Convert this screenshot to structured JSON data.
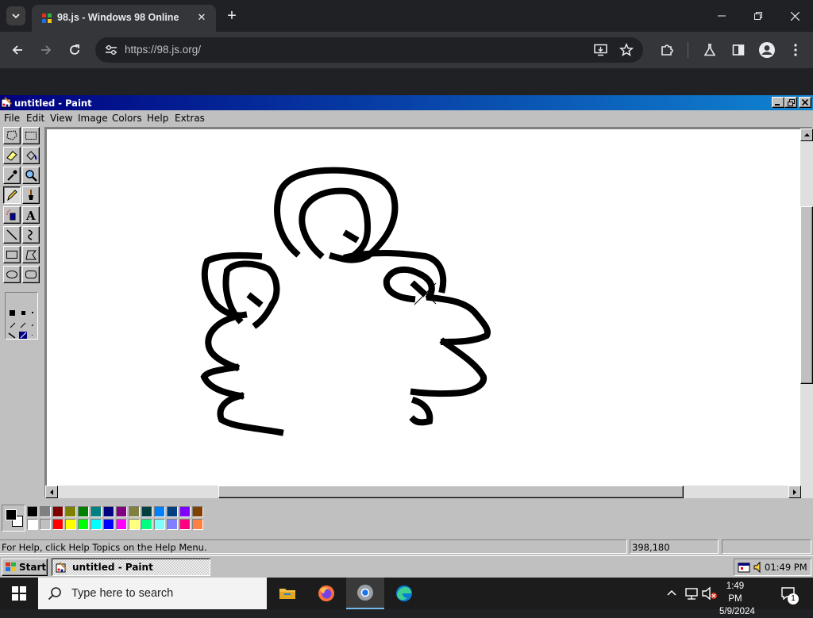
{
  "browser": {
    "tab_title": "98.js - Windows 98 Online",
    "url": "https://98.js.org/"
  },
  "paint": {
    "title": "untitled - Paint",
    "menu": [
      "File",
      "Edit",
      "View",
      "Image",
      "Colors",
      "Help",
      "Extras"
    ],
    "status_help": "For Help, click Help Topics on the Help Menu.",
    "cursor_position": "398,180",
    "selection_size": "",
    "primary_color": "#000000",
    "secondary_color": "#ffffff",
    "palette_row1": [
      "#000000",
      "#808080",
      "#800000",
      "#808000",
      "#008000",
      "#008080",
      "#000080",
      "#800080",
      "#808040",
      "#004040",
      "#0080ff",
      "#004080",
      "#8000ff",
      "#804000"
    ],
    "palette_row2": [
      "#ffffff",
      "#c0c0c0",
      "#ff0000",
      "#ffff00",
      "#00ff00",
      "#00ffff",
      "#0000ff",
      "#ff00ff",
      "#ffff80",
      "#00ff80",
      "#80ffff",
      "#8080ff",
      "#ff0080",
      "#ff8040"
    ]
  },
  "win98_taskbar": {
    "start_label": "Start",
    "task_label": "untitled - Paint",
    "clock": "01:49 PM"
  },
  "win10_taskbar": {
    "search_placeholder": "Type here to search",
    "time": "1:49 PM",
    "date": "5/9/2024",
    "notification_count": "1"
  }
}
